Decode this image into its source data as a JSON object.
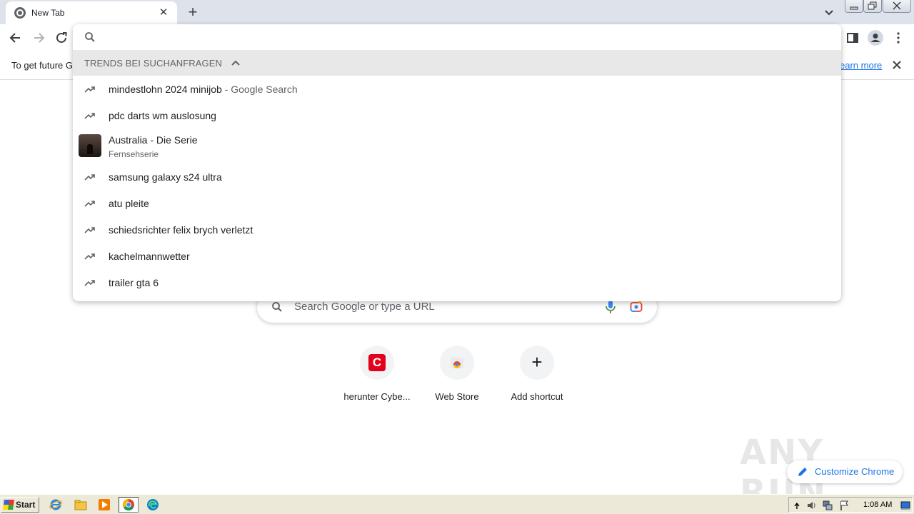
{
  "window": {
    "tab_title": "New Tab",
    "tab_close": "✕",
    "new_tab": "+"
  },
  "infobar": {
    "message": "To get future G",
    "learn_more": "earn more"
  },
  "omnibox": {
    "input_value": "",
    "trends_header": "TRENDS BEI SUCHANFRAGEN",
    "suggestions": [
      {
        "text": "mindestlohn 2024 minijob",
        "suffix": " - Google Search"
      },
      {
        "text": "pdc darts wm auslosung",
        "suffix": ""
      },
      {
        "text": "samsung galaxy s24 ultra",
        "suffix": ""
      },
      {
        "text": "atu pleite",
        "suffix": ""
      },
      {
        "text": "schiedsrichter felix brych verletzt",
        "suffix": ""
      },
      {
        "text": "kachelmannwetter",
        "suffix": ""
      },
      {
        "text": "trailer gta 6",
        "suffix": ""
      }
    ],
    "rich_suggestion": {
      "title": "Australia - Die Serie",
      "subtitle": "Fernsehserie"
    }
  },
  "ntp": {
    "search_placeholder": "Search Google or type a URL",
    "shortcuts": [
      {
        "name": "herunter Cybe...",
        "logo": "C"
      },
      {
        "name": "Web Store"
      },
      {
        "name": "Add shortcut",
        "logo": "+"
      }
    ],
    "customize_label": "Customize Chrome"
  },
  "watermark": "ANY RUN",
  "taskbar": {
    "start_label": "Start",
    "clock": "1:08 AM"
  },
  "colors": {
    "tabstrip_bg": "#dee3eb",
    "accent_blue": "#1a73e8",
    "cyberlink_red": "#e3001b"
  }
}
